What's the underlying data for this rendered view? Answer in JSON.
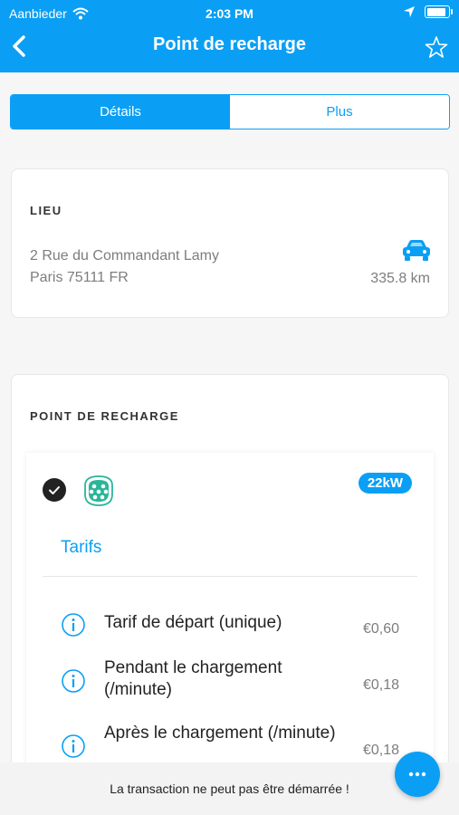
{
  "status_bar": {
    "carrier": "Aanbieder",
    "time": "2:03 PM"
  },
  "header": {
    "title": "Point de recharge"
  },
  "tabs": [
    {
      "label": "Détails",
      "active": true
    },
    {
      "label": "Plus",
      "active": false
    }
  ],
  "location": {
    "section_title": "LIEU",
    "address_line1": "2 Rue du Commandant Lamy",
    "address_line2": "Paris 75111 FR",
    "distance": "335.8 km"
  },
  "charge_point": {
    "section_title": "POINT DE RECHARGE",
    "power_badge": "22kW",
    "tarifs_label": "Tarifs",
    "tariffs": [
      {
        "label": "Tarif de départ (unique)",
        "price": "€0,60"
      },
      {
        "label": "Pendant le chargement (/minute)",
        "price": "€0,18"
      },
      {
        "label": "Après le chargement (/minute)",
        "price": "€0,18"
      }
    ]
  },
  "footer": {
    "message": "La transaction ne peut pas être démarrée !"
  },
  "colors": {
    "accent": "#0a9ff5"
  },
  "icons": [
    "back-chevron-icon",
    "star-icon",
    "wifi-icon",
    "location-arrow-icon",
    "battery-icon",
    "car-icon",
    "check-icon",
    "plug-icon",
    "info-icon",
    "more-icon"
  ]
}
